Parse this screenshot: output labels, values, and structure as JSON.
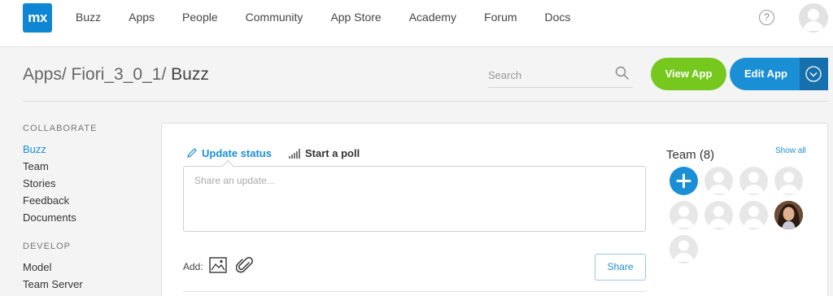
{
  "logo": "mx",
  "nav": {
    "items": [
      "Buzz",
      "Apps",
      "People",
      "Community",
      "App Store",
      "Academy",
      "Forum",
      "Docs"
    ],
    "help": "?"
  },
  "breadcrumb": {
    "part1": "Apps/",
    "part2": "Fiori_3_0_1/",
    "current": "Buzz"
  },
  "search": {
    "placeholder": "Search"
  },
  "buttons": {
    "view_app": "View App",
    "edit_app": "Edit App",
    "share": "Share"
  },
  "sidebar": {
    "collaborate_heading": "COLLABORATE",
    "collaborate_items": [
      "Buzz",
      "Team",
      "Stories",
      "Feedback",
      "Documents"
    ],
    "develop_heading": "DEVELOP",
    "develop_items": [
      "Model",
      "Team Server"
    ]
  },
  "composer": {
    "tab_update": "Update status",
    "tab_poll": "Start a poll",
    "placeholder": "Share an update...",
    "add_label": "Add:"
  },
  "team": {
    "title": "Team (8)",
    "show_all": "Show all"
  },
  "colors": {
    "accent": "#1b8fd6",
    "view_app_green": "#76c81f",
    "logo_blue": "#0f86d4"
  }
}
